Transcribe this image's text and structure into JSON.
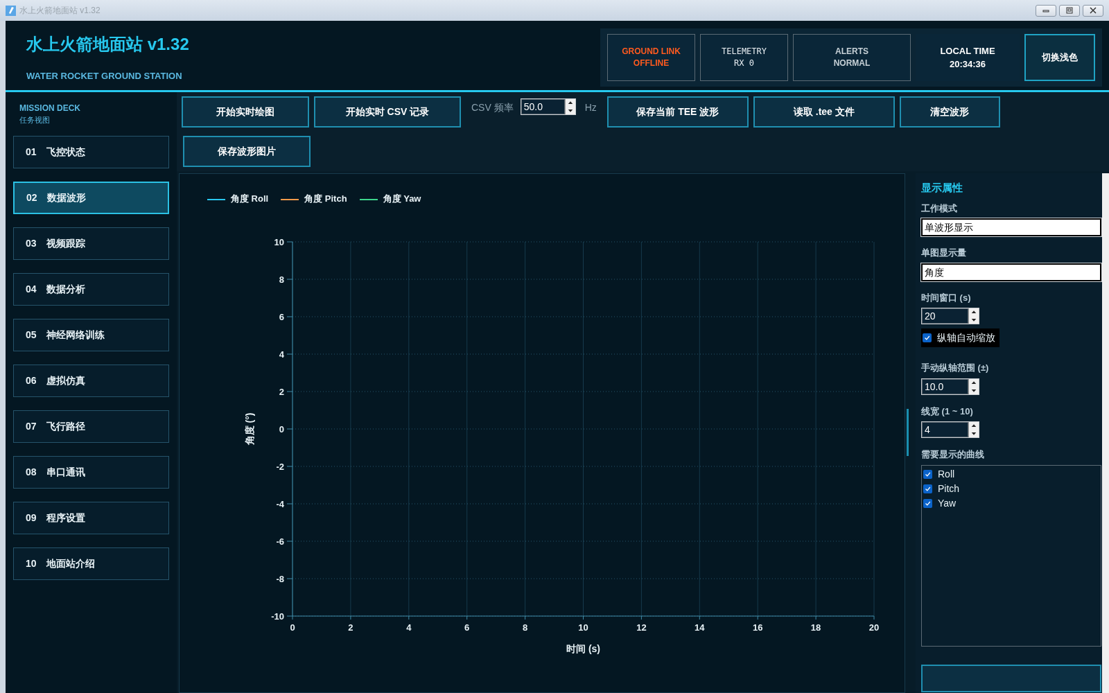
{
  "window": {
    "title": "水上火箭地面站 v1.32"
  },
  "header": {
    "title": "水上火箭地面站 v1.32",
    "subtitle": "WATER ROCKET GROUND STATION"
  },
  "status_cards": [
    {
      "kind": "link",
      "label": "GROUND LINK",
      "value": "OFFLINE"
    },
    {
      "kind": "telemetry",
      "label": "TELEMETRY",
      "value": "RX 0"
    },
    {
      "kind": "alerts",
      "label": "ALERTS",
      "value": "NORMAL"
    },
    {
      "kind": "clock",
      "label": "LOCAL TIME",
      "value": "20:34:36"
    }
  ],
  "theme_button": "切换浅色",
  "sidebar": {
    "title": "MISSION DECK",
    "subtitle": "任务视图",
    "items": [
      {
        "number": "01",
        "label": "飞控状态",
        "selected": false
      },
      {
        "number": "02",
        "label": "数据波形",
        "selected": true
      },
      {
        "number": "03",
        "label": "视频跟踪",
        "selected": false
      },
      {
        "number": "04",
        "label": "数据分析",
        "selected": false
      },
      {
        "number": "05",
        "label": "神经网络训练",
        "selected": false
      },
      {
        "number": "06",
        "label": "虚拟仿真",
        "selected": false
      },
      {
        "number": "07",
        "label": "飞行路径",
        "selected": false
      },
      {
        "number": "08",
        "label": "串口通讯",
        "selected": false
      },
      {
        "number": "09",
        "label": "程序设置",
        "selected": false
      },
      {
        "number": "10",
        "label": "地面站介绍",
        "selected": false
      }
    ]
  },
  "toolbar": {
    "rows": [
      [
        {
          "kind": "button",
          "label": "开始实时绘图"
        },
        {
          "kind": "button",
          "label": "开始实时 CSV 记录"
        },
        {
          "kind": "rate",
          "label": "CSV 频率",
          "value": "50.0",
          "unit": "Hz"
        },
        {
          "kind": "button",
          "label": "保存当前 TEE 波形"
        },
        {
          "kind": "button",
          "label": "读取 .tee 文件"
        },
        {
          "kind": "button",
          "label": "清空波形"
        }
      ],
      [
        {
          "kind": "button",
          "label": "保存波形图片"
        }
      ]
    ]
  },
  "chart": {
    "chart_data": {
      "type": "line",
      "xlabel": "时间 (s)",
      "ylabel": "角度 (°)",
      "series": [
        {
          "name": "角度 Roll",
          "color": "#29c8f0",
          "values": [
            null,
            null,
            null,
            null,
            null,
            null,
            null,
            null,
            null,
            null,
            null
          ]
        },
        {
          "name": "角度 Pitch",
          "color": "#f59a4a",
          "values": [
            null,
            null,
            null,
            null,
            null,
            null,
            null,
            null,
            null,
            null,
            null
          ]
        },
        {
          "name": "角度 Yaw",
          "color": "#3dd68c",
          "values": [
            null,
            null,
            null,
            null,
            null,
            null,
            null,
            null,
            null,
            null,
            null
          ]
        }
      ],
      "categories": [
        "0",
        "2",
        "4",
        "6",
        "8",
        "10",
        "12",
        "14",
        "16",
        "18",
        "20"
      ],
      "grid": true,
      "ylim": [
        -10,
        10
      ],
      "yticks": [
        -10,
        -8,
        -6,
        -4,
        -2,
        0,
        2,
        4,
        6,
        8,
        10
      ]
    }
  },
  "properties": {
    "title": "显示属性",
    "fields": [
      {
        "kind": "combo",
        "label": "工作模式",
        "value": "单波形显示"
      },
      {
        "kind": "combo",
        "label": "单图显示量",
        "value": "角度"
      },
      {
        "kind": "spin",
        "label": "时间窗口 (s)",
        "value": "20"
      },
      {
        "kind": "check",
        "label": "纵轴自动缩放",
        "checked": true
      },
      {
        "kind": "spin",
        "label": "手动纵轴范围 (±)",
        "value": "10.0"
      },
      {
        "kind": "spin",
        "label": "线宽 (1 ~ 10)",
        "value": "4"
      },
      {
        "kind": "list",
        "label": "需要显示的曲线",
        "items": [
          {
            "label": "Roll",
            "checked": true
          },
          {
            "label": "Pitch",
            "checked": true
          },
          {
            "label": "Yaw",
            "checked": true
          }
        ]
      }
    ]
  }
}
